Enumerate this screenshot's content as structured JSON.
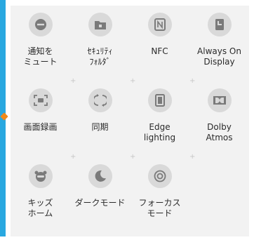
{
  "colors": {
    "accent_bar": "#29a8e0",
    "accent_marker": "#f08a1c",
    "panel_bg": "#f2f2f2",
    "icon_bg": "#d9d9d9",
    "icon_fg": "#7a7a7a"
  },
  "tiles": [
    {
      "label": "通知を\nミュート",
      "icon": "mute-notifications-icon"
    },
    {
      "label": "ｾｷｭﾘﾃｨ\nﾌｫﾙﾀﾞ",
      "icon": "secure-folder-icon"
    },
    {
      "label": "NFC",
      "icon": "nfc-icon"
    },
    {
      "label": "Always On\nDisplay",
      "icon": "always-on-display-icon"
    },
    {
      "label": "画面録画",
      "icon": "screen-recorder-icon"
    },
    {
      "label": "同期",
      "icon": "sync-icon"
    },
    {
      "label": "Edge\nlighting",
      "icon": "edge-lighting-icon"
    },
    {
      "label": "Dolby\nAtmos",
      "icon": "dolby-atmos-icon"
    },
    {
      "label": "キッズ\nホーム",
      "icon": "kids-home-icon"
    },
    {
      "label": "ダークモード",
      "icon": "dark-mode-icon"
    },
    {
      "label": "フォーカス\nモード",
      "icon": "focus-mode-icon"
    }
  ],
  "separator_glyph": "+"
}
